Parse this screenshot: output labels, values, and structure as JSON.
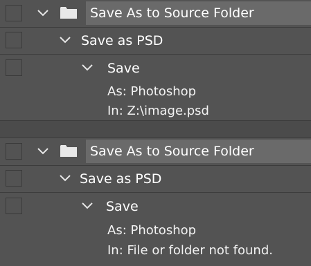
{
  "actions": [
    {
      "title": "Save As to Source Folder",
      "step": "Save as PSD",
      "command": "Save",
      "details": [
        "As: Photoshop",
        "In: Z:\\image.psd"
      ]
    },
    {
      "title": "Save As to Source Folder",
      "step": "Save as PSD",
      "command": "Save",
      "details": [
        "As: Photoshop",
        "In: File or folder not found."
      ]
    }
  ],
  "icons": {
    "toggle": "checkbox-icon",
    "expand": "chevron-down-icon",
    "set": "folder-icon"
  }
}
